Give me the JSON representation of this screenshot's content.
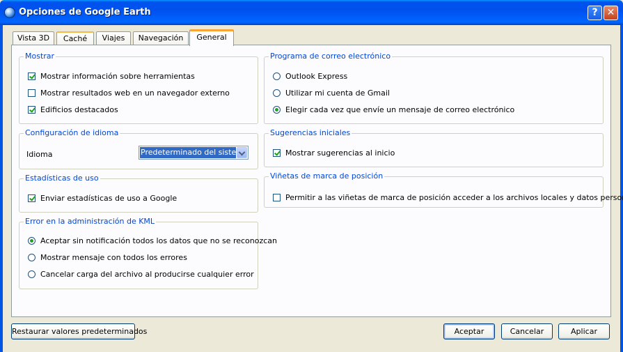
{
  "window": {
    "title": "Opciones de Google Earth",
    "help_glyph": "?",
    "close_glyph": "✕"
  },
  "tabs": [
    {
      "label": "Vista 3D"
    },
    {
      "label": "Caché"
    },
    {
      "label": "Viajes"
    },
    {
      "label": "Navegación"
    },
    {
      "label": "General"
    }
  ],
  "active_tab": "General",
  "mostrar": {
    "title": "Mostrar",
    "options": [
      {
        "label": "Mostrar información sobre herramientas",
        "checked": true
      },
      {
        "label": "Mostrar resultados web en un navegador externo",
        "checked": false
      },
      {
        "label": "Edificios destacados",
        "checked": true
      }
    ]
  },
  "idioma": {
    "title": "Configuración de idioma",
    "label": "Idioma",
    "selected": "Predeterminado del sistema"
  },
  "estadisticas": {
    "title": "Estadísticas de uso",
    "option": {
      "label": "Enviar estadísticas de uso a Google",
      "checked": true
    }
  },
  "kml": {
    "title": "Error en la administración de KML",
    "options": [
      {
        "label": "Aceptar sin notificación todos los datos que no se reconozcan",
        "selected": true
      },
      {
        "label": "Mostrar mensaje con todos los errores",
        "selected": false
      },
      {
        "label": "Cancelar carga del archivo al producirse cualquier error",
        "selected": false
      }
    ]
  },
  "correo": {
    "title": "Programa de correo electrónico",
    "options": [
      {
        "label": "Outlook Express",
        "selected": false
      },
      {
        "label": "Utilizar mi cuenta de Gmail",
        "selected": false
      },
      {
        "label": "Elegir cada vez que envíe un mensaje de correo electrónico",
        "selected": true
      }
    ]
  },
  "sugerencias": {
    "title": "Sugerencias iniciales",
    "option": {
      "label": "Mostrar sugerencias al inicio",
      "checked": true
    }
  },
  "vinetas": {
    "title": "Viñetas de marca de posición",
    "option": {
      "label": "Permitir a las viñetas de marca de posición acceder a los archivos locales y datos personales",
      "checked": false
    }
  },
  "buttons": {
    "restore": "Restaurar valores predeterminados",
    "accept": "Aceptar",
    "cancel": "Cancelar",
    "apply": "Aplicar"
  },
  "colors": {
    "title_bar": "#0054e3",
    "group_title": "#0046d5",
    "dialog_bg": "#ece9d8",
    "check_mark": "#21a121"
  }
}
